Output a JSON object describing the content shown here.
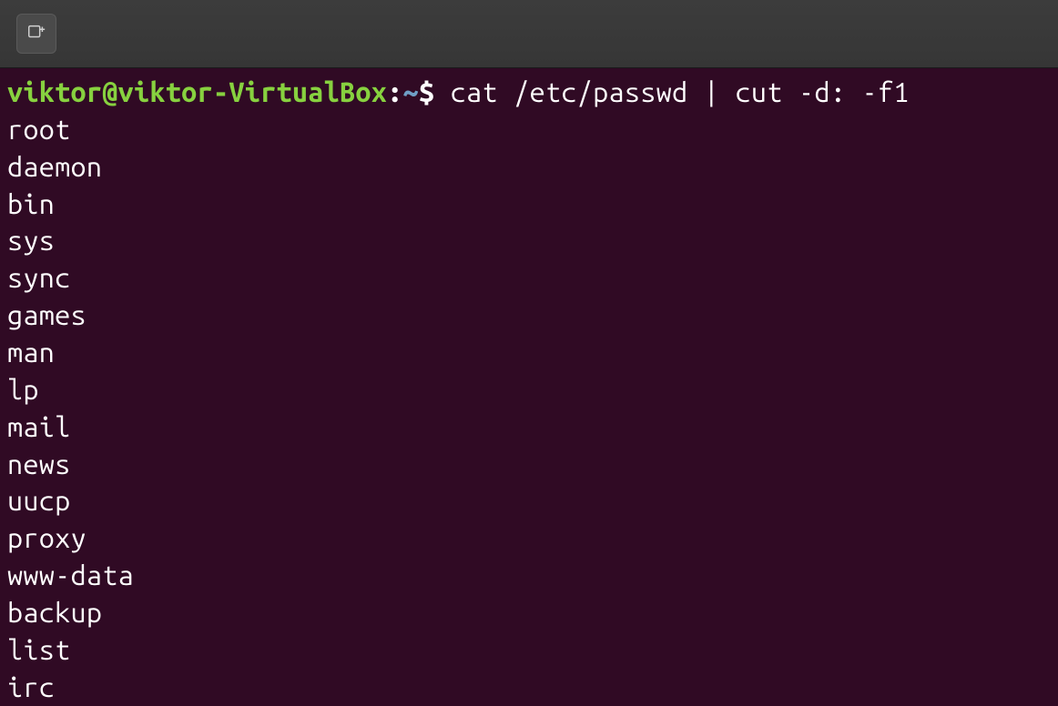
{
  "titlebar": {
    "new_tab_icon": "new-tab-icon"
  },
  "prompt": {
    "user_host": "viktor@viktor-VirtualBox",
    "colon": ":",
    "path": "~",
    "dollar": "$",
    "command": " cat /etc/passwd | cut -d: -f1"
  },
  "output": [
    "root",
    "daemon",
    "bin",
    "sys",
    "sync",
    "games",
    "man",
    "lp",
    "mail",
    "news",
    "uucp",
    "proxy",
    "www-data",
    "backup",
    "list",
    "irc"
  ]
}
